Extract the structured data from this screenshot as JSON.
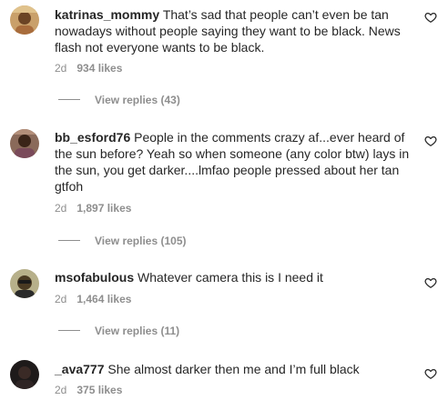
{
  "comments": [
    {
      "username": "katrinas_mommy",
      "text": "That’s sad that people can’t even be tan nowadays without people saying they want to be black. News flash not everyone wants to be black.",
      "time": "2d",
      "likes": "934 likes",
      "view_replies": "View replies (43)",
      "avatar_icon": "avatar-photo"
    },
    {
      "username": "bb_esford76",
      "text": "People in the comments crazy af...ever heard of the sun before? Yeah so when someone (any color btw) lays in the sun, you get darker....lmfao people pressed about her tan gtfoh",
      "time": "2d",
      "likes": "1,897 likes",
      "view_replies": "View replies (105)",
      "avatar_icon": "avatar-photo"
    },
    {
      "username": "msofabulous",
      "text": "Whatever camera this is I need it",
      "time": "2d",
      "likes": "1,464 likes",
      "view_replies": "View replies (11)",
      "avatar_icon": "avatar-photo"
    },
    {
      "username": "_ava777",
      "text": "She almost darker then me and I’m full black",
      "time": "2d",
      "likes": "375 likes",
      "avatar_icon": "avatar-photo"
    }
  ],
  "icons": {
    "like": "heart-icon"
  },
  "colors": {
    "text": "#262626",
    "secondary": "#8e8e8e",
    "background": "#ffffff"
  }
}
